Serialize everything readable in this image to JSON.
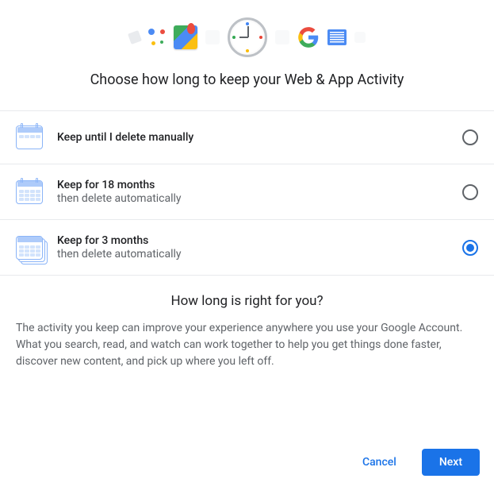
{
  "title": "Choose how long to keep your Web & App Activity",
  "options": [
    {
      "title": "Keep until I delete manually",
      "sub": "",
      "selected": false
    },
    {
      "title": "Keep for 18 months",
      "sub": "then delete automatically",
      "selected": false
    },
    {
      "title": "Keep for 3 months",
      "sub": "then delete automatically",
      "selected": true
    }
  ],
  "info": {
    "title": "How long is right for you?",
    "body": "The activity you keep can improve your experience anywhere you use your Google Account. What you search, read, and watch can work together to help you get things done faster, discover new content, and pick up where you left off."
  },
  "buttons": {
    "cancel": "Cancel",
    "next": "Next"
  },
  "icons": {
    "tag": "tag-icon",
    "assistant": "assistant-icon",
    "maps": "maps-icon",
    "clock": "clock-icon",
    "google": "google-g-icon",
    "news": "news-icon",
    "placeholder": "placeholder-tile"
  }
}
